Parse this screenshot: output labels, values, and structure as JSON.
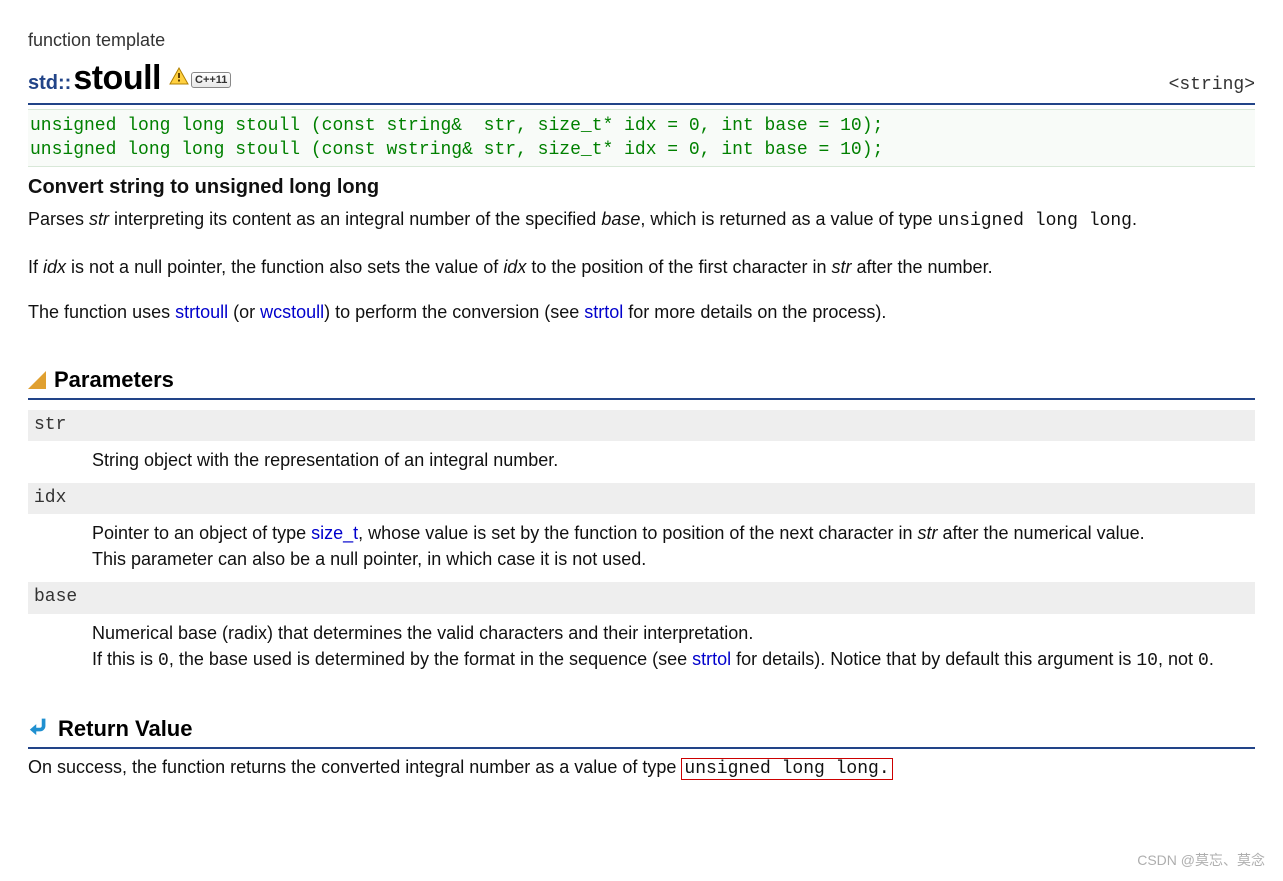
{
  "category": "function template",
  "namespace": "std::",
  "fn_name": "stoull",
  "header": "<string>",
  "badges": {
    "cpp": "C++11"
  },
  "signatures": "unsigned long long stoull (const string&  str, size_t* idx = 0, int base = 10);\nunsigned long long stoull (const wstring& str, size_t* idx = 0, int base = 10);",
  "short_desc": "Convert string to unsigned long long",
  "desc": {
    "p1_a": "Parses ",
    "p1_str": "str",
    "p1_b": " interpreting its content as an integral number of the specified ",
    "p1_base": "base",
    "p1_c": ", which is returned as a value of type ",
    "p1_type": "unsigned long long",
    "p1_d": ".",
    "p2_a": "If ",
    "p2_idx": "idx",
    "p2_b": " is not a null pointer, the function also sets the value of ",
    "p2_idx2": "idx",
    "p2_c": " to the position of the first character in ",
    "p2_str": "str",
    "p2_d": " after the number.",
    "p3_a": "The function uses ",
    "p3_l1": "strtoull",
    "p3_b": " (or ",
    "p3_l2": "wcstoull",
    "p3_c": ") to perform the conversion (see ",
    "p3_l3": "strtol",
    "p3_d": " for more details on the process)."
  },
  "sections": {
    "parameters": "Parameters",
    "return_value": "Return Value"
  },
  "params": {
    "str": {
      "name": "str",
      "desc": "String object with the representation of an integral number."
    },
    "idx": {
      "name": "idx",
      "a": "Pointer to an object of type ",
      "link": "size_t",
      "b": ", whose value is set by the function to position of the next character in ",
      "str": "str",
      "c": " after the numerical value.",
      "line2": "This parameter can also be a null pointer, in which case it is not used."
    },
    "base": {
      "name": "base",
      "line1": "Numerical base (radix) that determines the valid characters and their interpretation.",
      "a": "If this is ",
      "zero": "0",
      "b": ", the base used is determined by the format in the sequence (see ",
      "link": "strtol",
      "c": " for details). Notice that by default this argument is ",
      "ten": "10",
      "d": ", not ",
      "zero2": "0",
      "e": "."
    }
  },
  "return": {
    "a": "On success, the function returns the converted integral number as a value of type",
    "type": "unsigned long long."
  },
  "watermark": "CSDN @莫忘、莫念"
}
